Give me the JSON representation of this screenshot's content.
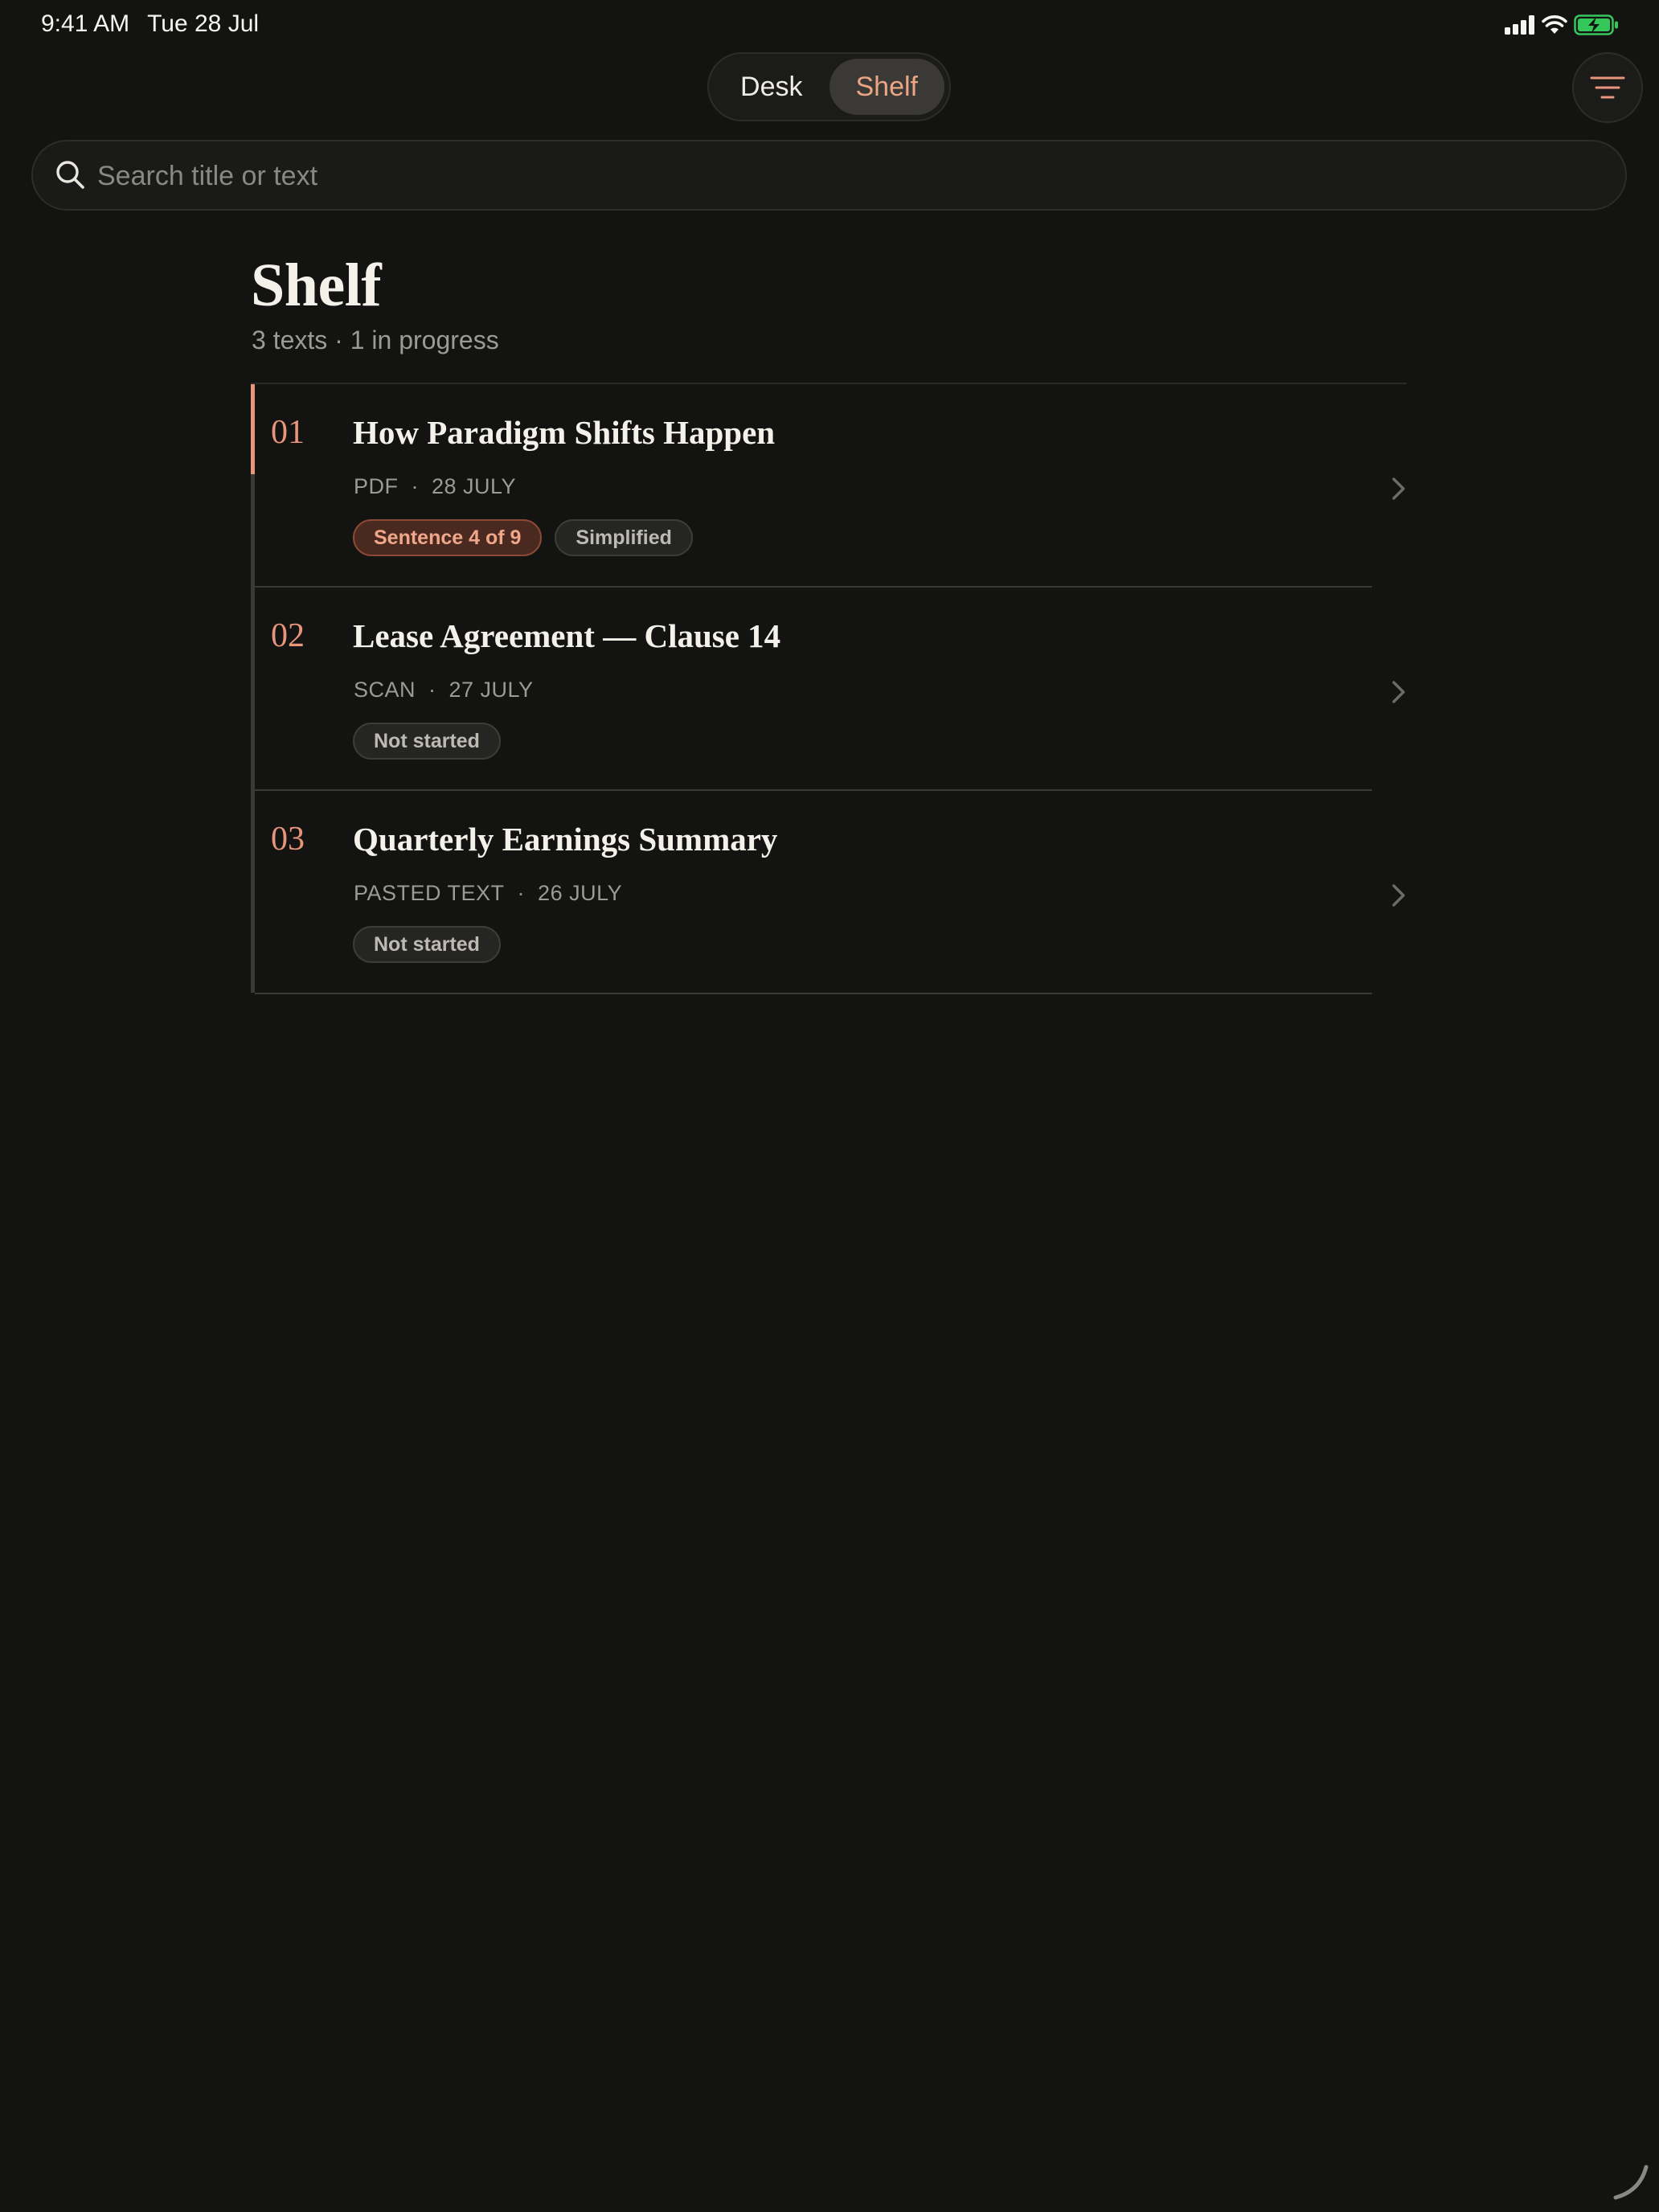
{
  "status_bar": {
    "time": "9:41 AM",
    "date": "Tue 28 Jul",
    "icons": [
      "signal-icon",
      "wifi-icon",
      "battery-charging-icon"
    ],
    "battery_color": "#34c759"
  },
  "segmented": {
    "options": [
      "Desk",
      "Shelf"
    ],
    "selected": "Shelf"
  },
  "menu_icon": "filter-lines-icon",
  "search": {
    "placeholder": "Search title or text",
    "value": ""
  },
  "header": {
    "title": "Shelf",
    "subtitle": "3 texts · 1 in progress"
  },
  "items": [
    {
      "num": "01",
      "title": "How Paradigm Shifts Happen",
      "source": "PDF",
      "date": "28 JULY",
      "tags": [
        {
          "label": "Sentence 4 of 9",
          "kind": "progress"
        },
        {
          "label": "Simplified",
          "kind": "neutral"
        }
      ]
    },
    {
      "num": "02",
      "title": "Lease Agreement — Clause 14",
      "source": "SCAN",
      "date": "27 JULY",
      "tags": [
        {
          "label": "Not started",
          "kind": "neutral"
        }
      ]
    },
    {
      "num": "03",
      "title": "Quarterly Earnings Summary",
      "source": "PASTED TEXT",
      "date": "26 JULY",
      "tags": [
        {
          "label": "Not started",
          "kind": "neutral"
        }
      ]
    }
  ],
  "colors": {
    "accent": "#e8957a",
    "background": "#131312"
  }
}
